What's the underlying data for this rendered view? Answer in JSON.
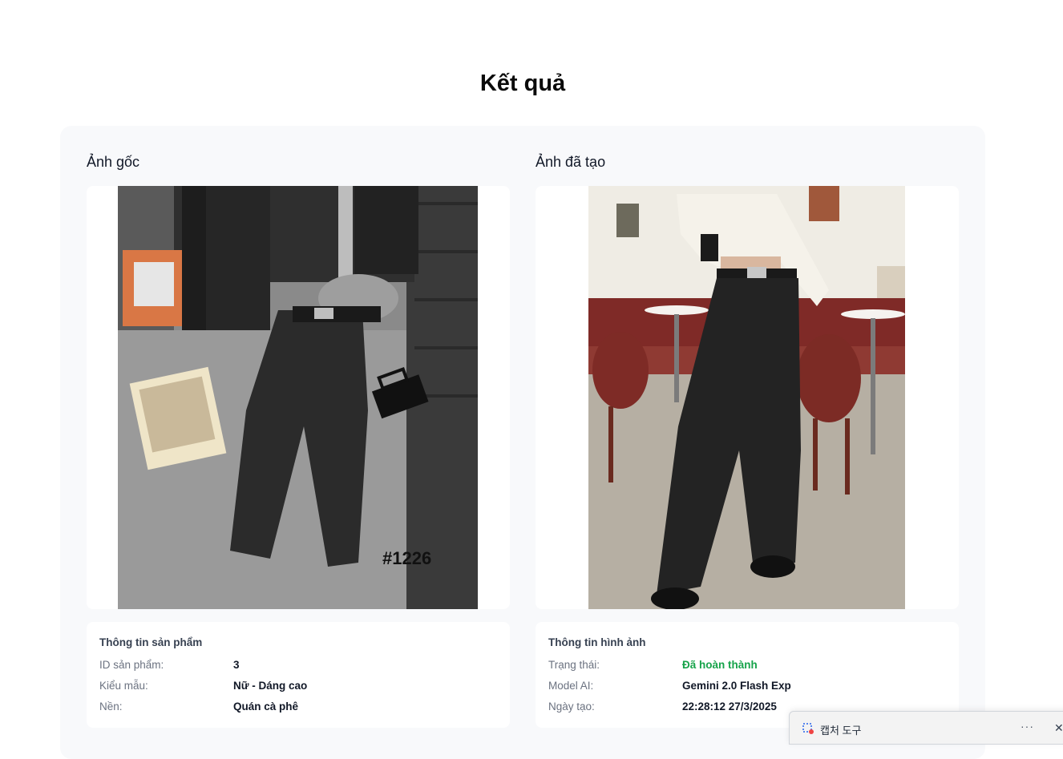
{
  "page": {
    "title": "Kết quả"
  },
  "original": {
    "heading": "Ảnh gốc",
    "image_label": "#1226"
  },
  "generated": {
    "heading": "Ảnh đã tạo"
  },
  "product_info": {
    "title": "Thông tin sản phẩm",
    "rows": [
      {
        "label": "ID sản phẩm:",
        "value": "3"
      },
      {
        "label": "Kiểu mẫu:",
        "value": "Nữ - Dáng cao"
      },
      {
        "label": "Nền:",
        "value": "Quán cà phê"
      }
    ]
  },
  "image_info": {
    "title": "Thông tin hình ảnh",
    "rows": [
      {
        "label": "Trạng thái:",
        "value": "Đã hoàn thành"
      },
      {
        "label": "Model AI:",
        "value": "Gemini 2.0 Flash Exp"
      },
      {
        "label": "Ngày tạo:",
        "value": "22:28:12 27/3/2025"
      }
    ]
  },
  "snip_tool": {
    "title": "캡처 도구",
    "more": "···",
    "close": "✕"
  },
  "colors": {
    "status_success": "#16a34a",
    "card_bg": "#f8f9fb"
  }
}
